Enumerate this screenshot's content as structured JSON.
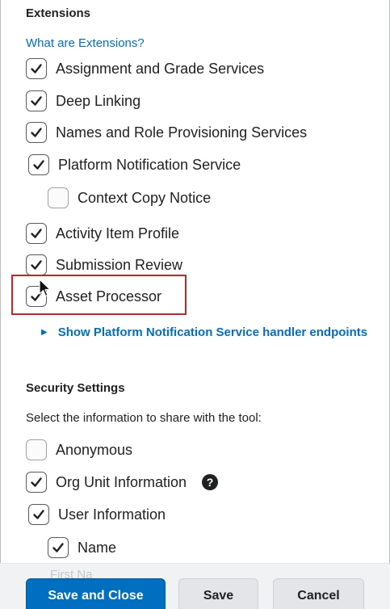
{
  "extensions": {
    "heading": "Extensions",
    "help_link": "What are Extensions?",
    "items": [
      {
        "label": "Assignment and Grade Services",
        "checked": true
      },
      {
        "label": "Deep Linking",
        "checked": true
      },
      {
        "label": "Names and Role Provisioning Services",
        "checked": true
      },
      {
        "label": "Platform Notification Service",
        "checked": true
      },
      {
        "label": "Context Copy Notice",
        "checked": false
      },
      {
        "label": "Activity Item Profile",
        "checked": true
      },
      {
        "label": "Submission Review",
        "checked": true
      },
      {
        "label": "Asset Processor",
        "checked": true
      }
    ],
    "toggle_label": "Show Platform Notification Service handler endpoints"
  },
  "security": {
    "heading": "Security Settings",
    "description": "Select the information to share with the tool:",
    "items": [
      {
        "label": "Anonymous",
        "checked": false
      },
      {
        "label": "Org Unit Information",
        "checked": true
      },
      {
        "label": "User Information",
        "checked": true
      },
      {
        "label": "Name",
        "checked": true
      }
    ],
    "partial_item": "First Na"
  },
  "footer": {
    "save_close": "Save and Close",
    "save": "Save",
    "cancel": "Cancel"
  },
  "colors": {
    "accent": "#006fbf",
    "highlight": "#c0272d"
  }
}
